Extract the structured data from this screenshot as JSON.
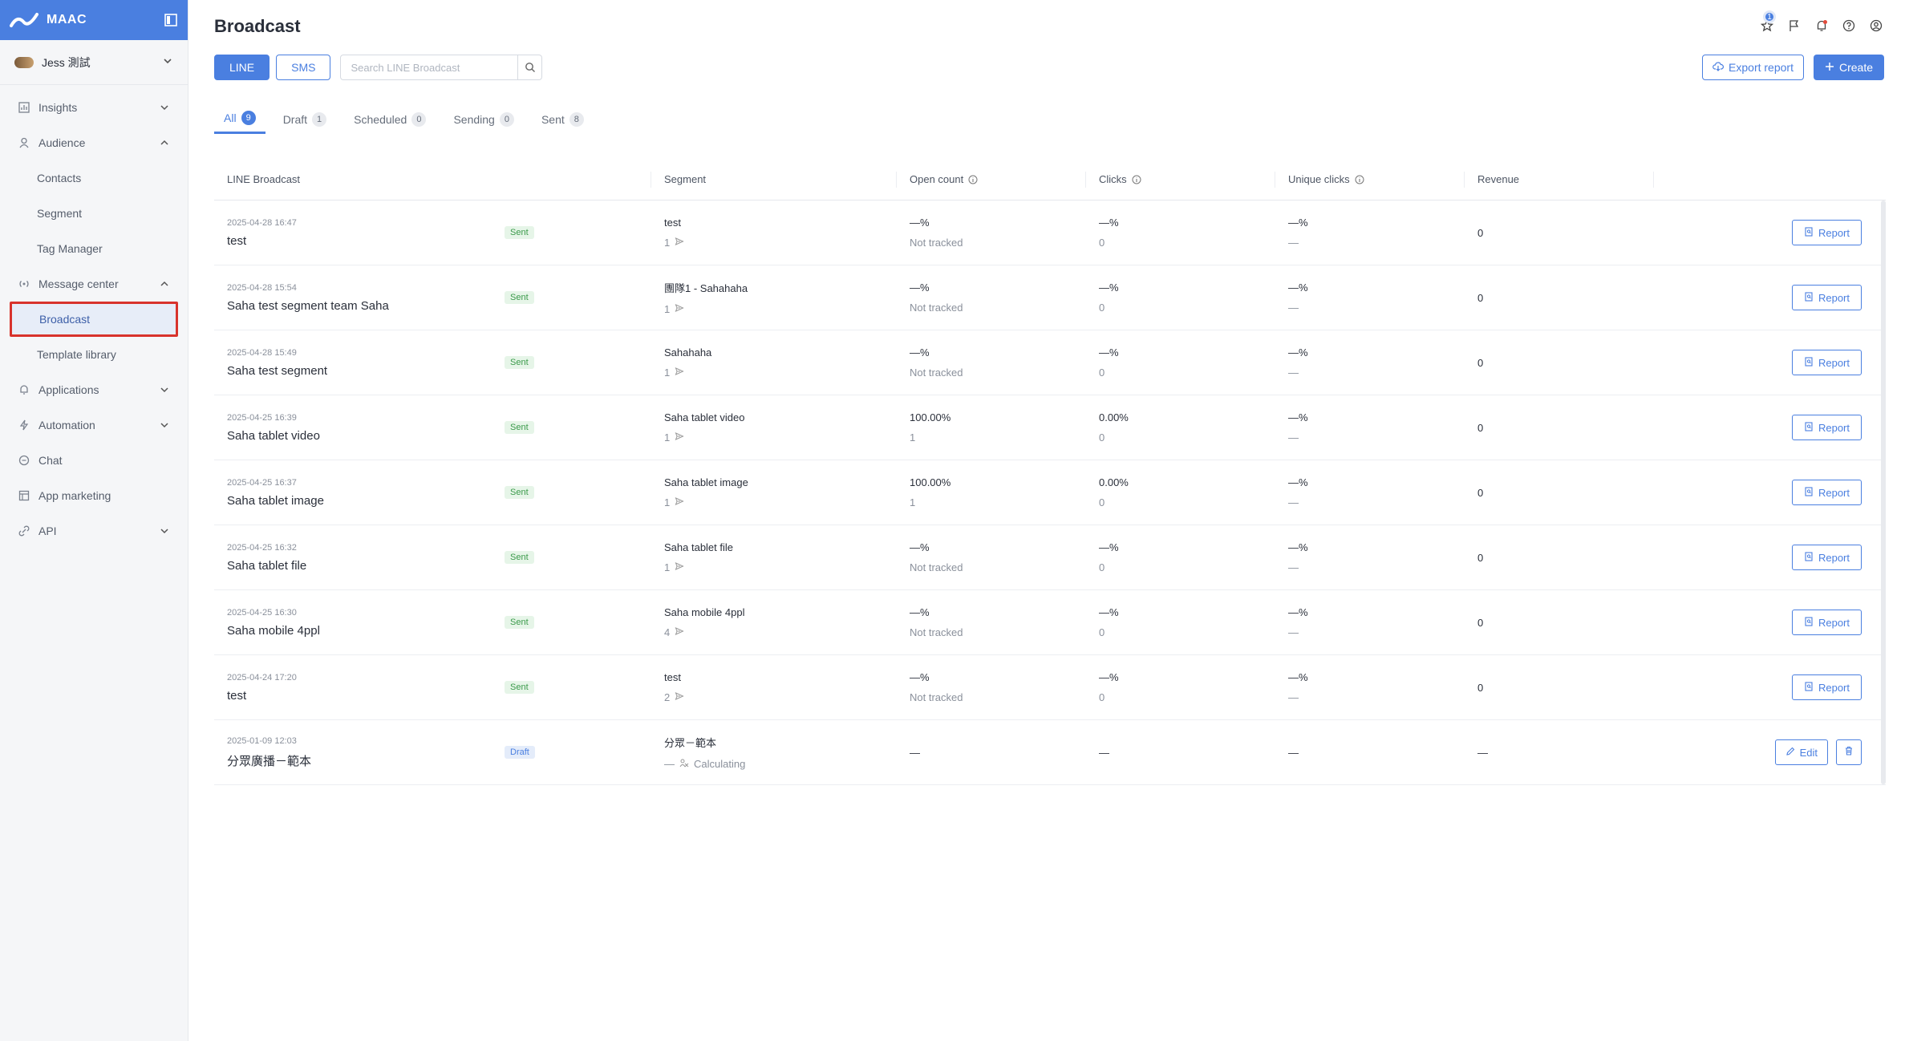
{
  "sidebar": {
    "brand": "MAAC",
    "account": "Jess 測試",
    "items": [
      {
        "label": "Insights"
      },
      {
        "label": "Audience"
      },
      {
        "label": "Contacts"
      },
      {
        "label": "Segment"
      },
      {
        "label": "Tag Manager"
      },
      {
        "label": "Message center"
      },
      {
        "label": "Broadcast"
      },
      {
        "label": "Template library"
      },
      {
        "label": "Applications"
      },
      {
        "label": "Automation"
      },
      {
        "label": "Chat"
      },
      {
        "label": "App marketing"
      },
      {
        "label": "API"
      }
    ]
  },
  "header": {
    "title": "Broadcast",
    "notification_count": "1"
  },
  "channels": {
    "line": "LINE",
    "sms": "SMS"
  },
  "search": {
    "placeholder": "Search LINE Broadcast"
  },
  "actions": {
    "export": "Export report",
    "create": "Create"
  },
  "tabs": [
    {
      "label": "All",
      "count": "9"
    },
    {
      "label": "Draft",
      "count": "1"
    },
    {
      "label": "Scheduled",
      "count": "0"
    },
    {
      "label": "Sending",
      "count": "0"
    },
    {
      "label": "Sent",
      "count": "8"
    }
  ],
  "table": {
    "headers": {
      "name": "LINE Broadcast",
      "segment": "Segment",
      "open": "Open count",
      "clicks": "Clicks",
      "unique": "Unique clicks",
      "revenue": "Revenue"
    },
    "rows": [
      {
        "date": "2025-04-28 16:47",
        "title": "test",
        "status": "Sent",
        "segment": "test",
        "seg_count": "1",
        "open1": "—%",
        "open2": "Not tracked",
        "click1": "—%",
        "click2": "0",
        "uniq1": "—%",
        "uniq2": "—",
        "revenue": "0",
        "action": "Report"
      },
      {
        "date": "2025-04-28 15:54",
        "title": "Saha test segment team Saha",
        "status": "Sent",
        "segment": "團隊1 - Sahahaha",
        "seg_count": "1",
        "open1": "—%",
        "open2": "Not tracked",
        "click1": "—%",
        "click2": "0",
        "uniq1": "—%",
        "uniq2": "—",
        "revenue": "0",
        "action": "Report"
      },
      {
        "date": "2025-04-28 15:49",
        "title": "Saha test segment",
        "status": "Sent",
        "segment": "Sahahaha",
        "seg_count": "1",
        "open1": "—%",
        "open2": "Not tracked",
        "click1": "—%",
        "click2": "0",
        "uniq1": "—%",
        "uniq2": "—",
        "revenue": "0",
        "action": "Report"
      },
      {
        "date": "2025-04-25 16:39",
        "title": "Saha tablet video",
        "status": "Sent",
        "segment": "Saha tablet video",
        "seg_count": "1",
        "open1": "100.00%",
        "open2": "1",
        "click1": "0.00%",
        "click2": "0",
        "uniq1": "—%",
        "uniq2": "—",
        "revenue": "0",
        "action": "Report"
      },
      {
        "date": "2025-04-25 16:37",
        "title": "Saha tablet image",
        "status": "Sent",
        "segment": "Saha tablet image",
        "seg_count": "1",
        "open1": "100.00%",
        "open2": "1",
        "click1": "0.00%",
        "click2": "0",
        "uniq1": "—%",
        "uniq2": "—",
        "revenue": "0",
        "action": "Report"
      },
      {
        "date": "2025-04-25 16:32",
        "title": "Saha tablet file",
        "status": "Sent",
        "segment": "Saha tablet file",
        "seg_count": "1",
        "open1": "—%",
        "open2": "Not tracked",
        "click1": "—%",
        "click2": "0",
        "uniq1": "—%",
        "uniq2": "—",
        "revenue": "0",
        "action": "Report"
      },
      {
        "date": "2025-04-25 16:30",
        "title": "Saha mobile 4ppl",
        "status": "Sent",
        "segment": "Saha mobile 4ppl",
        "seg_count": "4",
        "open1": "—%",
        "open2": "Not tracked",
        "click1": "—%",
        "click2": "0",
        "uniq1": "—%",
        "uniq2": "—",
        "revenue": "0",
        "action": "Report"
      },
      {
        "date": "2025-04-24 17:20",
        "title": "test",
        "status": "Sent",
        "segment": "test",
        "seg_count": "2",
        "open1": "—%",
        "open2": "Not tracked",
        "click1": "—%",
        "click2": "0",
        "uniq1": "—%",
        "uniq2": "—",
        "revenue": "0",
        "action": "Report"
      }
    ],
    "draft_row": {
      "date": "2025-01-09 12:03",
      "title": "分眾廣播－範本",
      "status": "Draft",
      "segment": "分眾－範本",
      "seg_count": "—",
      "calc": "Calculating",
      "open1": "—",
      "click1": "—",
      "uniq1": "—",
      "revenue": "—",
      "edit": "Edit"
    }
  },
  "colors": {
    "accent": "#4a7fe0",
    "sent": "#3b9a4b",
    "highlight": "#d8332c"
  }
}
